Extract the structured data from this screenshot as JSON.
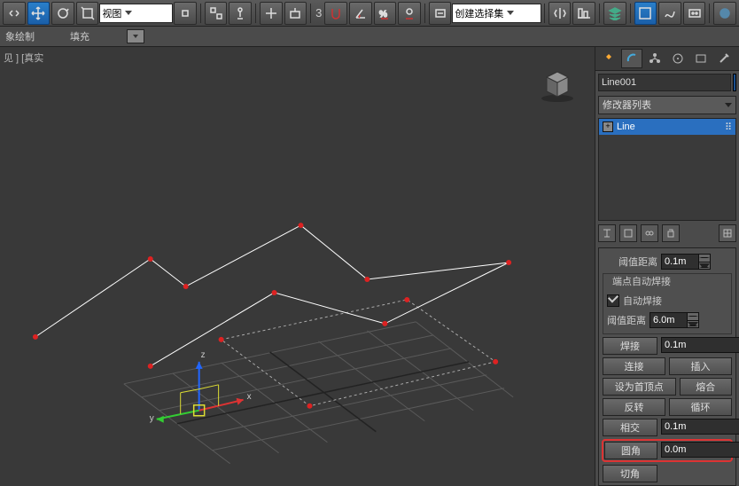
{
  "toolbar": {
    "viewDropdown": "视图",
    "three": "3",
    "createSet": "创建选择集"
  },
  "secondRow": {
    "tab1": "象绘制",
    "tab2": "填充"
  },
  "viewport": {
    "label": "见 ] [真实"
  },
  "side": {
    "objectName": "Line001",
    "modifierList": "修改器列表",
    "stackItem": "Line",
    "rollout": {
      "thresholdLabel": "阈值距离",
      "thresholdVal": "0.1m",
      "autoWeldGroup": "端点自动焊接",
      "autoWeld": "自动焊接",
      "thresholdLabel2": "阈值距离",
      "thresholdVal2": "6.0m",
      "weld": "焊接",
      "weldVal": "0.1m",
      "connect": "连接",
      "insert": "插入",
      "setFirst": "设为首顶点",
      "fuse": "熔合",
      "reverse": "反转",
      "cycle": "循环",
      "crossSection": "相交",
      "crossVal": "0.1m",
      "fillet": "圆角",
      "filletVal": "0.0m",
      "chamfer": "切角"
    }
  }
}
